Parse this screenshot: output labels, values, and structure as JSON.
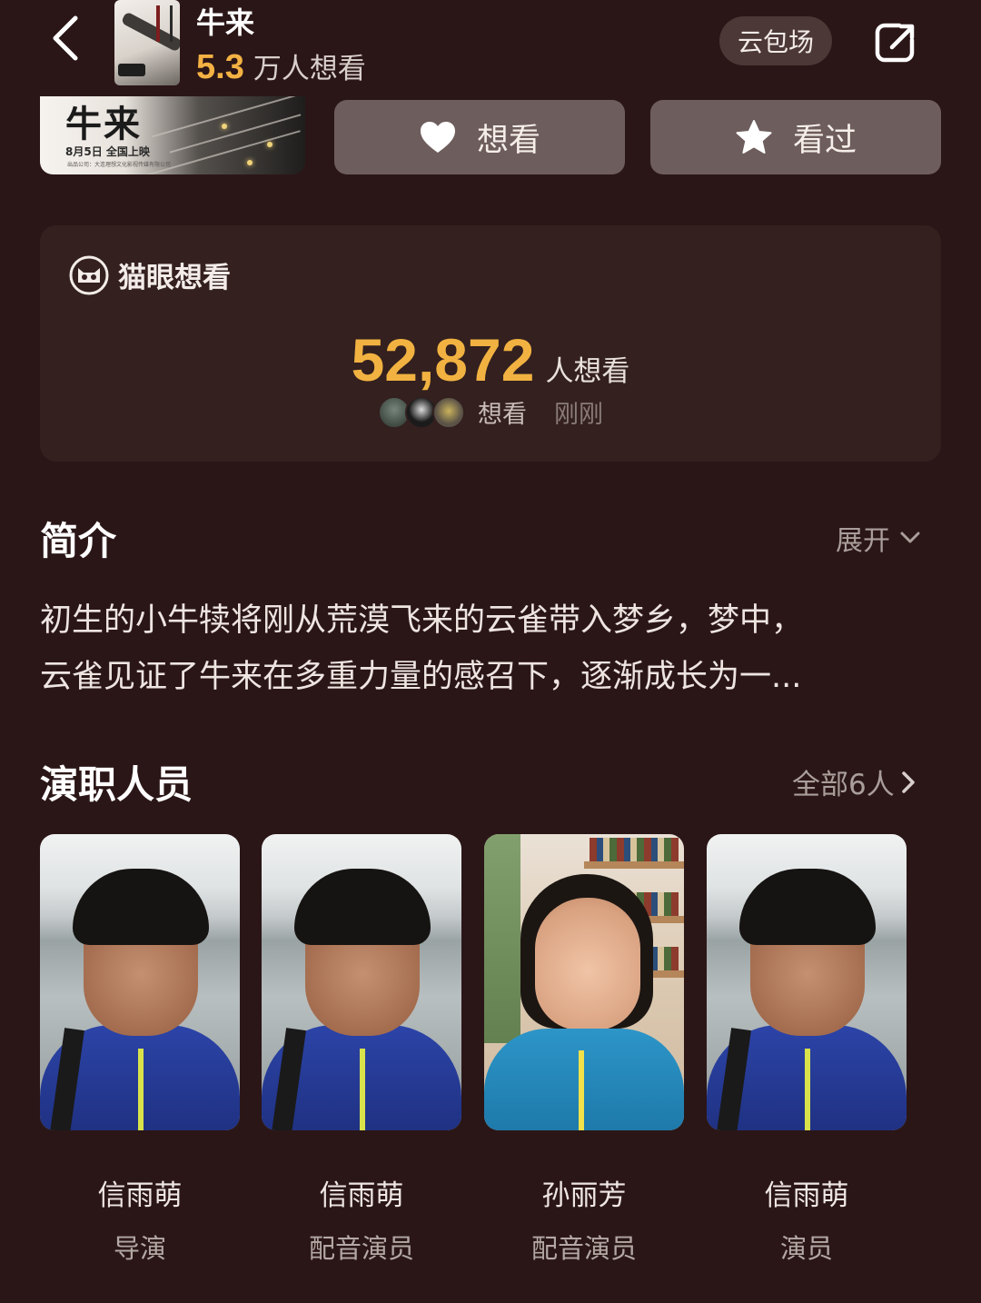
{
  "header": {
    "title": "牛来",
    "want_count": "5.3",
    "want_unit": "万人想看",
    "cloud_button": "云包场"
  },
  "poster": {
    "title": "牛来",
    "release": "8月5日 全国上映",
    "fine_print": "出品公司：大连理想文化影视传媒有限公司"
  },
  "actions": {
    "want_label": "想看",
    "seen_label": "看过"
  },
  "maoyan": {
    "title": "猫眼想看",
    "count": "52,872",
    "count_unit": "人想看",
    "recent_label": "想看",
    "recent_time": "刚刚"
  },
  "intro": {
    "title": "简介",
    "expand_label": "展开",
    "line1": "初生的小牛犊将刚从荒漠飞来的云雀带入梦乡，梦中，",
    "line2": "云雀见证了牛来在多重力量的感召下，逐渐成长为一..."
  },
  "cast": {
    "title": "演职人员",
    "all_label": "全部6人",
    "members": [
      {
        "name": "信雨萌",
        "role": "导演"
      },
      {
        "name": "信雨萌",
        "role": "配音演员"
      },
      {
        "name": "孙丽芳",
        "role": "配音演员"
      },
      {
        "name": "信雨萌",
        "role": "演员"
      }
    ]
  },
  "colors": {
    "background": "#2b1617",
    "accent": "#f2b241",
    "button_bg": "#6e5d5d"
  }
}
